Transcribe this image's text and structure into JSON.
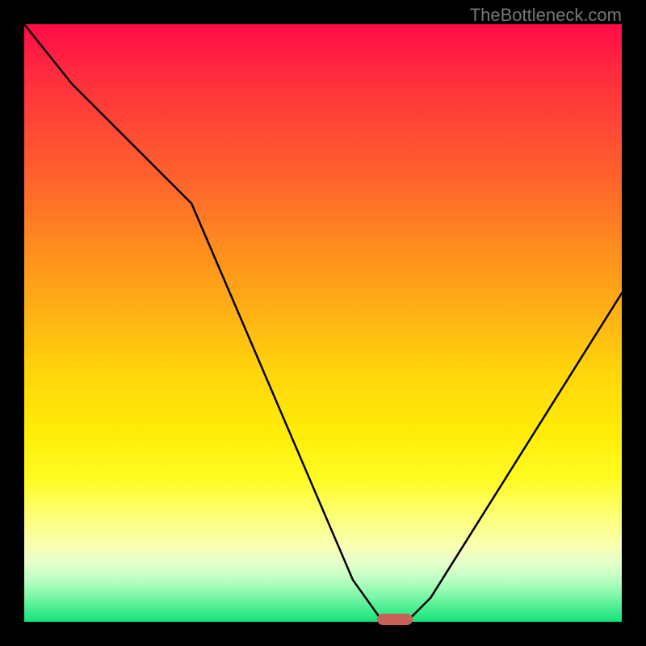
{
  "watermark": "TheBottleneck.com",
  "chart_data": {
    "type": "line",
    "title": "",
    "xlabel": "",
    "ylabel": "",
    "xlim": [
      0,
      100
    ],
    "ylim": [
      0,
      100
    ],
    "x": [
      0,
      8,
      28,
      55,
      60,
      64,
      68,
      100
    ],
    "values": [
      100,
      90,
      70,
      7,
      0,
      0,
      4,
      55
    ],
    "marker": {
      "x": 62,
      "y": 0
    },
    "gradient_stops": [
      {
        "pos": 0,
        "color": "#ff0b46"
      },
      {
        "pos": 8,
        "color": "#ff2b3f"
      },
      {
        "pos": 18,
        "color": "#ff4a34"
      },
      {
        "pos": 28,
        "color": "#ff6a2a"
      },
      {
        "pos": 38,
        "color": "#ff8f1e"
      },
      {
        "pos": 48,
        "color": "#ffb015"
      },
      {
        "pos": 58,
        "color": "#ffd40b"
      },
      {
        "pos": 68,
        "color": "#ffec07"
      },
      {
        "pos": 76,
        "color": "#fffb22"
      },
      {
        "pos": 82,
        "color": "#fdff72"
      },
      {
        "pos": 87,
        "color": "#faffae"
      },
      {
        "pos": 90,
        "color": "#e8ffcb"
      },
      {
        "pos": 93,
        "color": "#b9ffc3"
      },
      {
        "pos": 96,
        "color": "#75f6a4"
      },
      {
        "pos": 100,
        "color": "#14e37a"
      }
    ]
  }
}
